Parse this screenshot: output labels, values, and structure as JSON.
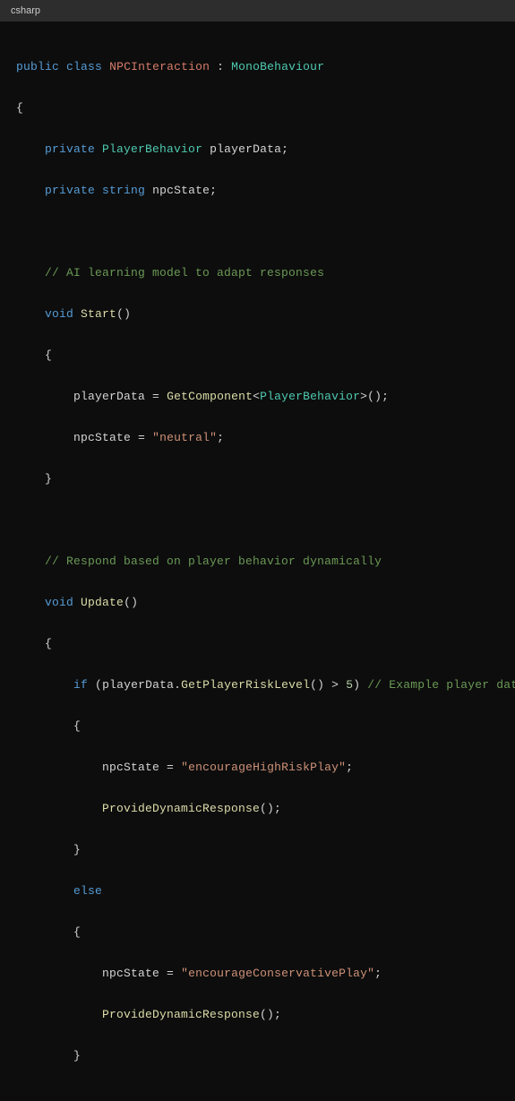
{
  "header": {
    "language": "csharp"
  },
  "code": {
    "l1": {
      "kw1": "public",
      "kw2": "class",
      "cls": "NPCInteraction",
      "colon": ":",
      "base": "MonoBehaviour"
    },
    "l2": {
      "brace": "{"
    },
    "l3": {
      "kw1": "private",
      "type": "PlayerBehavior",
      "name": "playerData",
      "semi": ";"
    },
    "l4": {
      "kw1": "private",
      "type": "string",
      "name": "npcState",
      "semi": ";"
    },
    "l6": {
      "comment": "// AI learning model to adapt responses"
    },
    "l7": {
      "ret": "void",
      "name": "Start",
      "parens": "()"
    },
    "l8": {
      "brace": "{"
    },
    "l9": {
      "lhs": "playerData",
      "eq": "=",
      "fn": "GetComponent",
      "lt": "<",
      "gen": "PlayerBehavior",
      "gt": ">",
      "call": "();"
    },
    "l10": {
      "lhs": "npcState",
      "eq": "=",
      "str": "\"neutral\"",
      "semi": ";"
    },
    "l11": {
      "brace": "}"
    },
    "l13": {
      "comment": "// Respond based on player behavior dynamically"
    },
    "l14": {
      "ret": "void",
      "name": "Update",
      "parens": "()"
    },
    "l15": {
      "brace": "{"
    },
    "l16": {
      "kw": "if",
      "open": "(",
      "obj": "playerData",
      "dot": ".",
      "fn": "GetPlayerRiskLevel",
      "call": "()",
      "op": ">",
      "num": "5",
      "close": ")",
      "comment": "// Example player data"
    },
    "l17": {
      "brace": "{"
    },
    "l18": {
      "lhs": "npcState",
      "eq": "=",
      "str": "\"encourageHighRiskPlay\"",
      "semi": ";"
    },
    "l19": {
      "fn": "ProvideDynamicResponse",
      "call": "();"
    },
    "l20": {
      "brace": "}"
    },
    "l21": {
      "kw": "else"
    },
    "l22": {
      "brace": "{"
    },
    "l23": {
      "lhs": "npcState",
      "eq": "=",
      "str": "\"encourageConservativePlay\"",
      "semi": ";"
    },
    "l24": {
      "fn": "ProvideDynamicResponse",
      "call": "();"
    },
    "l25": {
      "brace": "}"
    }
  }
}
